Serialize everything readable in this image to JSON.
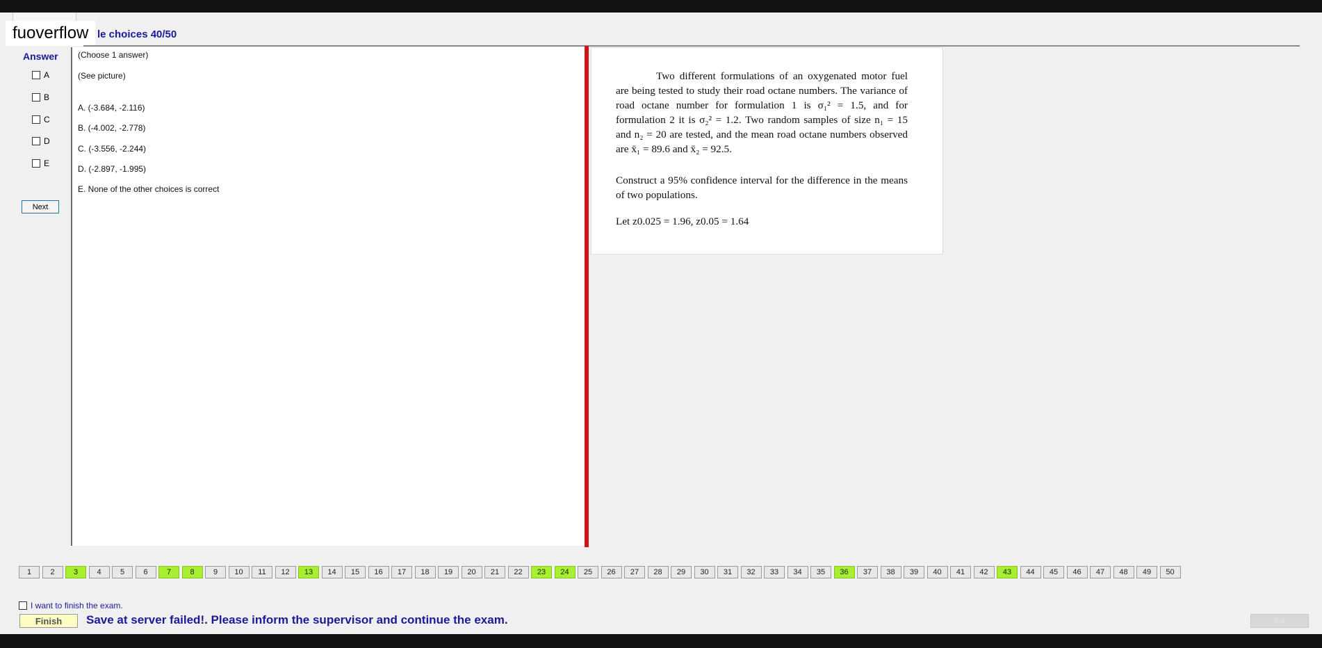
{
  "watermark": "fuoverflow",
  "header": {
    "title": "le choices 40/50"
  },
  "answer": {
    "label": "Answer",
    "options": [
      "A",
      "B",
      "C",
      "D",
      "E"
    ],
    "next_label": "Next"
  },
  "question": {
    "choose": "(Choose 1 answer)",
    "see_picture": "(See picture)",
    "choices": [
      "A. (-3.684,  -2.116)",
      "B. (-4.002, -2.778)",
      "C. (-3.556,  -2.244)",
      "D. (-2.897, -1.995)",
      "E. None of the other choices is correct"
    ]
  },
  "problem": {
    "p1": "Two different formulations of an oxygenated motor fuel are being tested to study their road octane numbers. The variance of road octane number for formulation 1 is σ₁² = 1.5, and for formulation 2 it is σ₂² = 1.2. Two random samples of size n₁ = 15 and n₂ = 20 are tested, and the mean road octane numbers observed are x̄₁ = 89.6 and x̄₂ = 92.5.",
    "p2": "Construct a 95% confidence interval for the difference in the means of two populations.",
    "p3": "Let z0.025 = 1.96,   z0.05 = 1.64"
  },
  "nav": {
    "numbers": [
      "1",
      "2",
      "3",
      "4",
      "5",
      "6",
      "7",
      "8",
      "9",
      "10",
      "11",
      "12",
      "13",
      "14",
      "15",
      "16",
      "17",
      "18",
      "19",
      "20",
      "21",
      "22",
      "23",
      "24",
      "25",
      "26",
      "27",
      "28",
      "29",
      "30",
      "31",
      "32",
      "33",
      "34",
      "35",
      "36",
      "37",
      "38",
      "39",
      "40",
      "41",
      "42",
      "43",
      "44",
      "45",
      "46",
      "47",
      "48",
      "49",
      "50"
    ],
    "answered": [
      3,
      7,
      8,
      13,
      23,
      24,
      36,
      43
    ],
    "answered_color": "#a6f02f"
  },
  "footer": {
    "finish_check_label": "I want to finish the exam.",
    "finish_label": "Finish",
    "status": "Save at server failed!. Please inform the supervisor and continue the exam.",
    "exit_label": "Exit"
  }
}
